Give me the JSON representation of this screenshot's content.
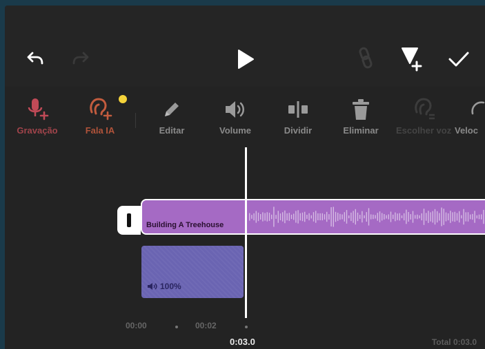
{
  "toolbar": {
    "items": [
      {
        "label": "Gravação"
      },
      {
        "label": "Fala IA"
      },
      {
        "label": "Editar"
      },
      {
        "label": "Volume"
      },
      {
        "label": "Dividir"
      },
      {
        "label": "Eliminar"
      },
      {
        "label": "Escolher voz"
      },
      {
        "label": "Veloc"
      }
    ]
  },
  "timeline": {
    "clip_title": "Building A Treehouse",
    "volume": "100%",
    "ticks": [
      "00:00",
      "00:02"
    ],
    "current_time": "0:03.0",
    "total": "Total 0:03.0"
  },
  "colors": {
    "accent_rec": "#a0444b",
    "accent_ai": "#b0533a",
    "badge": "#f5d33a",
    "audio_clip": "#a56ac4",
    "volume_clip": "#6a64b2"
  }
}
